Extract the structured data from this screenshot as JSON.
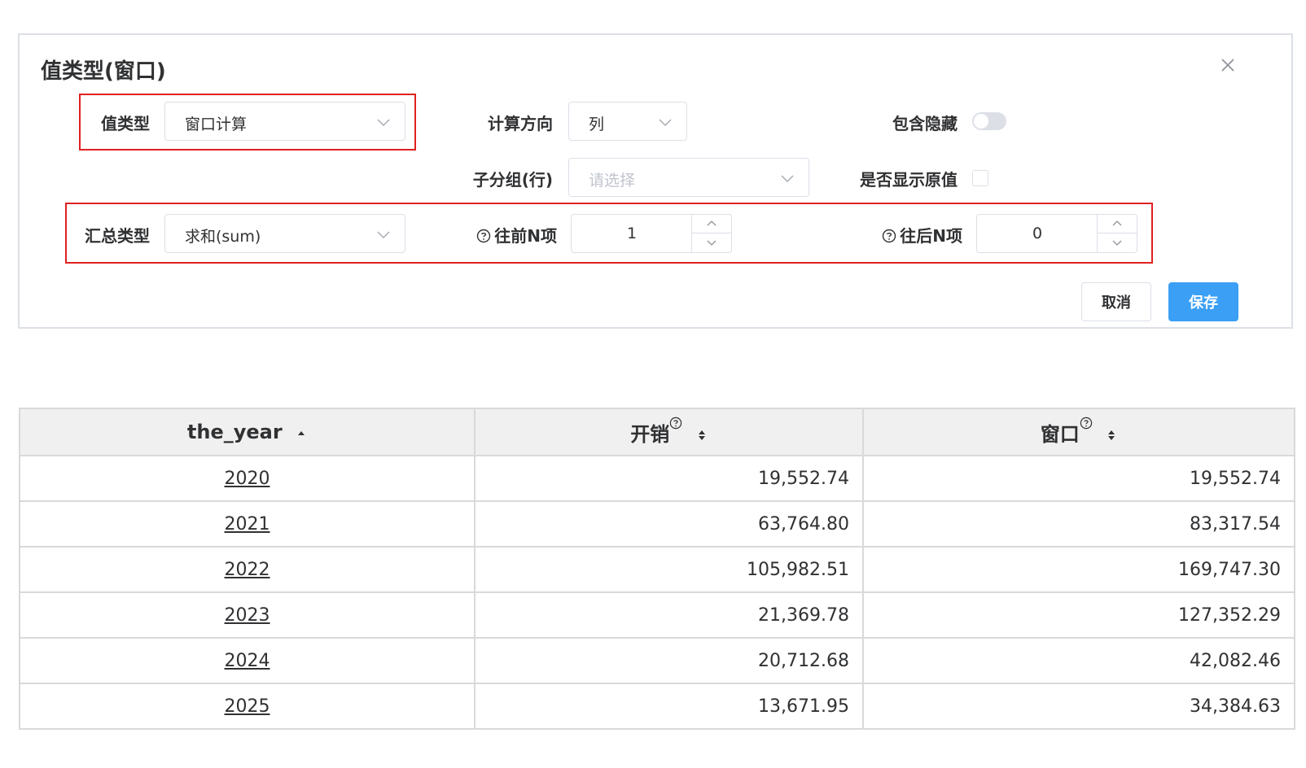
{
  "dialog": {
    "title": "值类型(窗口)",
    "value_type": {
      "label": "值类型",
      "value": "窗口计算"
    },
    "calc_direction": {
      "label": "计算方向",
      "value": "列"
    },
    "include_hidden": {
      "label": "包含隐藏",
      "on": false
    },
    "subgroup": {
      "label": "子分组(行)",
      "placeholder": "请选择"
    },
    "show_original": {
      "label": "是否显示原值",
      "checked": false
    },
    "agg_type": {
      "label": "汇总类型",
      "value": "求和(sum)"
    },
    "prev_n": {
      "label": "往前N项",
      "value": "1"
    },
    "next_n": {
      "label": "往后N项",
      "value": "0"
    },
    "cancel_label": "取消",
    "save_label": "保存"
  },
  "table": {
    "headers": [
      "the_year",
      "开销",
      "窗口"
    ],
    "rows": [
      [
        "2020",
        "19,552.74",
        "19,552.74"
      ],
      [
        "2021",
        "63,764.80",
        "83,317.54"
      ],
      [
        "2022",
        "105,982.51",
        "169,747.30"
      ],
      [
        "2023",
        "21,369.78",
        "127,352.29"
      ],
      [
        "2024",
        "20,712.68",
        "42,082.46"
      ],
      [
        "2025",
        "13,671.95",
        "34,384.63"
      ]
    ]
  },
  "colors": {
    "highlight": "#e02020",
    "primary": "#3a9ff5"
  }
}
